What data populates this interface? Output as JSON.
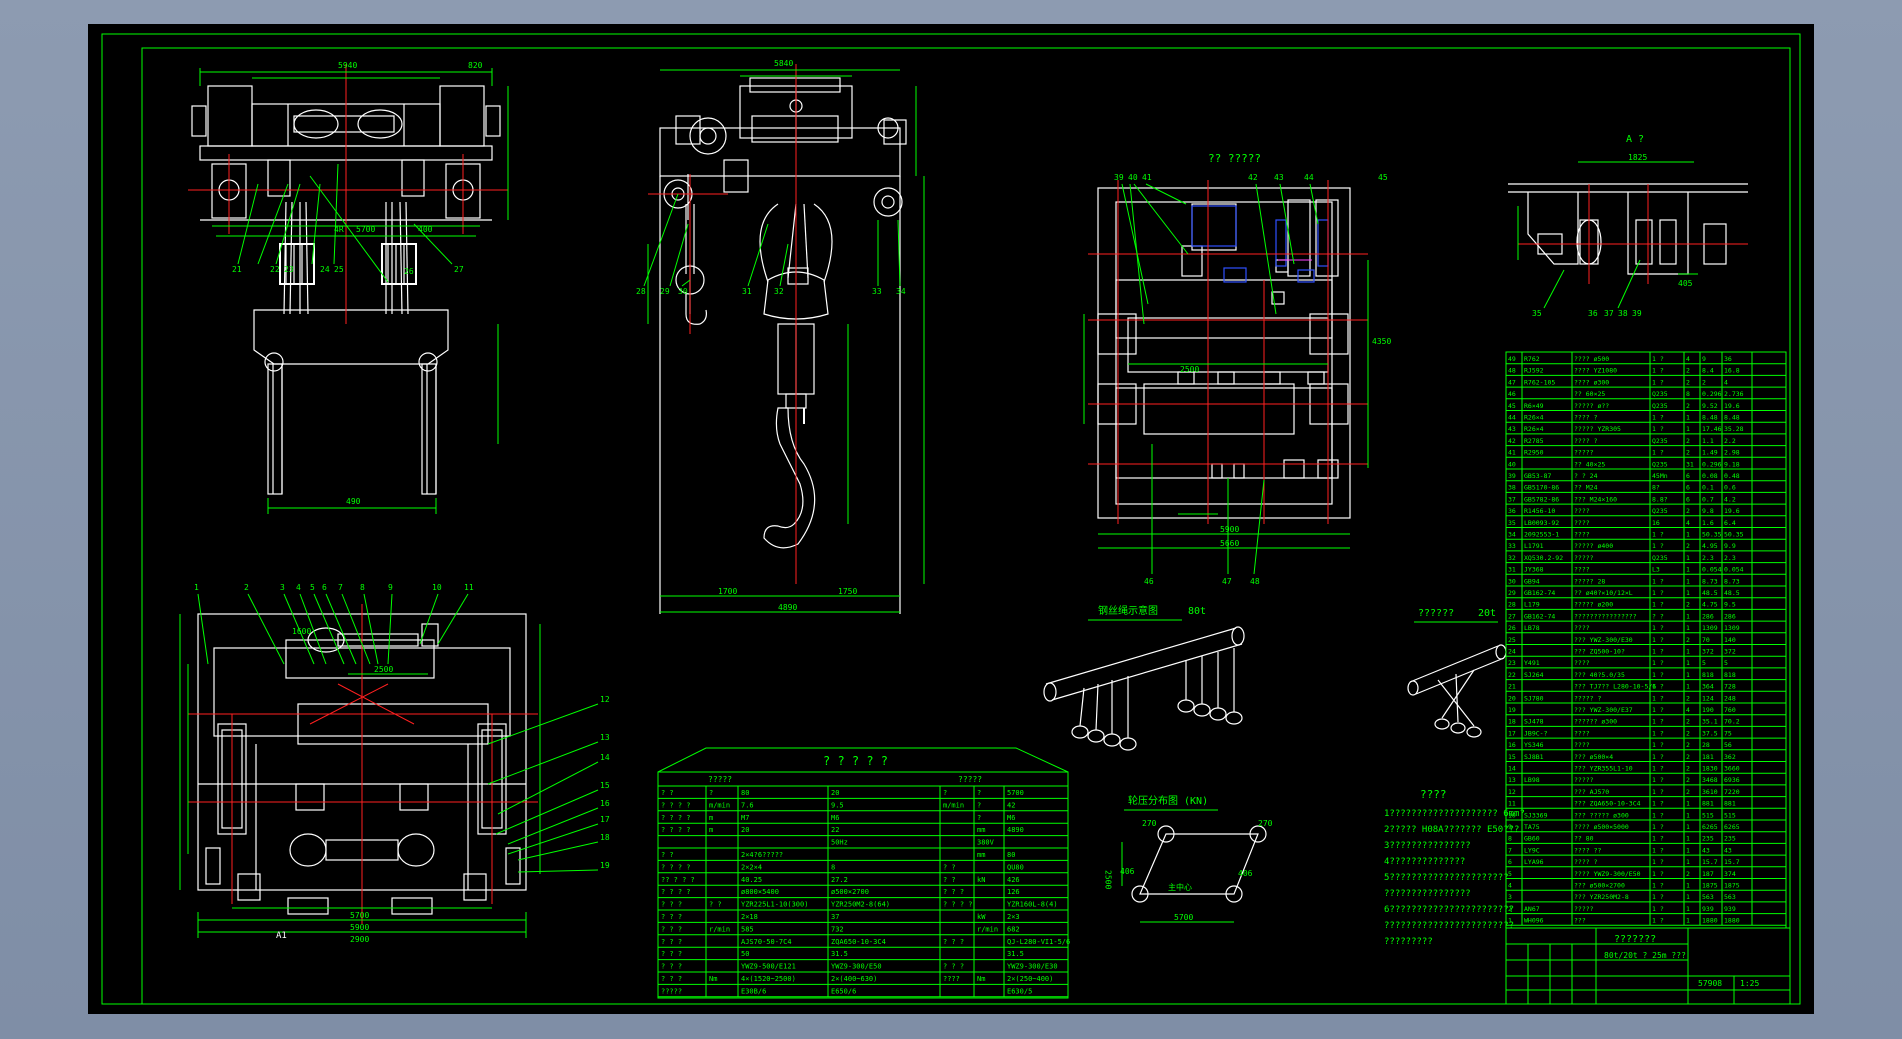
{
  "colors": {
    "background": "#8592a9",
    "sheet": "#000000",
    "frame": "#00ff00",
    "outline": "#ffffff",
    "centerline": "#ff2020",
    "dimension": "#00ff00",
    "blue": "#2040ff",
    "accent": "#ff00ff"
  },
  "frame": {
    "title_a": "A ?",
    "title_section": "?? ?????",
    "label_a1": "A1"
  },
  "front_view": {
    "dims": [
      "5940",
      "820",
      "4R",
      "5700",
      "300",
      "400",
      "490"
    ],
    "callouts": [
      "21",
      "22",
      "23",
      "24",
      "25",
      "26",
      "27"
    ]
  },
  "side_view": {
    "dims": [
      "5840",
      "1700",
      "1750",
      "4890"
    ],
    "callouts": [
      "28",
      "29",
      "30",
      "31",
      "32",
      "33",
      "34"
    ]
  },
  "plan_view": {
    "dims": [
      "5700",
      "5900",
      "2900",
      "2500",
      "1600"
    ],
    "callouts": [
      "1",
      "2",
      "3",
      "4",
      "5",
      "6",
      "7",
      "8",
      "9",
      "10",
      "11",
      "12",
      "13",
      "14",
      "15",
      "16",
      "17",
      "18",
      "19"
    ]
  },
  "section_view": {
    "dims": [
      "5900",
      "5660",
      "2500",
      "4350"
    ],
    "callouts": [
      "39",
      "40",
      "41",
      "42",
      "43",
      "44",
      "45",
      "46",
      "47",
      "48"
    ]
  },
  "detail_a": {
    "dims": [
      "1825",
      "5T",
      "405"
    ],
    "callouts": [
      "35",
      "36",
      "37",
      "38",
      "39"
    ]
  },
  "rope_main": {
    "title": "钢丝绳示意图",
    "capacity": "80t"
  },
  "rope_aux": {
    "title": "??????",
    "capacity": "20t"
  },
  "wheel_load": {
    "title": "轮压分布图 (KN)",
    "loads": [
      "270",
      "270",
      "406",
      "406"
    ],
    "dims": [
      "5700",
      "2500"
    ],
    "center_label": "主中心"
  },
  "notes": {
    "title": "????",
    "lines": [
      "1???????????????????? 6mm?",
      "2?????  H08A???????   E50???",
      "3???????????????",
      "4??????????????",
      "5??????????????????????",
      "   ????????????????",
      "6???????????????????????",
      "   ????????????????????????",
      "   ?????????"
    ]
  },
  "spec_table": {
    "title": "? ? ? ? ?",
    "header": [
      "?????",
      "?????"
    ],
    "rows": [
      [
        "? ?",
        "?",
        "80",
        "20",
        "?",
        "?",
        "5700"
      ],
      [
        "? ? ? ?",
        "m/min",
        "7.6",
        "9.5",
        "m/min",
        "?",
        "42"
      ],
      [
        "? ? ? ?",
        "m",
        "M7",
        "M6",
        "",
        "?",
        "M6"
      ],
      [
        "? ? ? ?",
        "m",
        "20",
        "22",
        "",
        "mm",
        "4890"
      ],
      [
        "",
        "",
        "",
        "50Hz",
        "",
        "380V",
        ""
      ],
      [
        "? ?",
        "",
        "2×4?6?????",
        "",
        "",
        "mm",
        "80"
      ],
      [
        "? ? ? ?",
        "",
        "2×2×4",
        "8",
        "? ?",
        "",
        "QU80"
      ],
      [
        "?? ? ? ?",
        "",
        "40.25",
        "27.2",
        "? ?",
        "kN",
        "426"
      ],
      [
        "? ? ? ?",
        "",
        "ø800×5400",
        "ø500×2700",
        "? ? ?",
        "",
        "126"
      ],
      [
        "? ? ?",
        "? ?",
        "YZR225L1-10(300)",
        "YZR250M2-8(64)",
        "? ? ? ?",
        "",
        "YZR160L-8(4)"
      ],
      [
        "? ? ?",
        "",
        "2×18",
        "37",
        "",
        "kW",
        "2×3"
      ],
      [
        "? ? ?",
        "r/min",
        "585",
        "732",
        "",
        "r/min",
        "682"
      ],
      [
        "? ? ?",
        "",
        "AJS70-50-7C4",
        "ZQA650-10-3C4",
        "? ? ?",
        "",
        "QJ-L280-VI1-5/6"
      ],
      [
        "? ? ?",
        "",
        "50",
        "31.5",
        "",
        "",
        "31.5"
      ],
      [
        "? ? ?",
        "",
        "YWZ9-500/E121",
        "YWZ9-300/E50",
        "? ? ?",
        "",
        "YWZ9-300/E30"
      ],
      [
        "? ? ?",
        "Nm",
        "4×(1520~2500)",
        "2×(400~630)",
        "????",
        "Nm",
        "2×(250~400)"
      ],
      [
        "?????",
        "",
        "E30B/6",
        "E650/6",
        "",
        "",
        "E630/5"
      ]
    ]
  },
  "bom": {
    "rows": [
      [
        "49",
        "R762",
        "???? ø500",
        "1 ?",
        "4",
        "9",
        "36"
      ],
      [
        "48",
        "RJ592",
        "???? YZ1080",
        "1 ?",
        "2",
        "8.4",
        "16.8"
      ],
      [
        "47",
        "R762-105",
        "???? ø300",
        "1 ?",
        "2",
        "2",
        "4"
      ],
      [
        "46",
        "",
        "?? 60×25",
        "Q235",
        "8",
        "0.296",
        "2.736"
      ],
      [
        "45",
        "R6×49",
        "????? ø??",
        "Q235",
        "2",
        "9.52",
        "19.6"
      ],
      [
        "44",
        "R26×4",
        "???? ?",
        "1 ?",
        "1",
        "8.48",
        "8.48"
      ],
      [
        "43",
        "R26×4",
        "????? YZR305",
        "1 ?",
        "1",
        "17.46",
        "35.28"
      ],
      [
        "42",
        "R2785",
        "???? ?",
        "Q235",
        "2",
        "1.1",
        "2.2"
      ],
      [
        "41",
        "R2950",
        "?????",
        "1 ?",
        "2",
        "1.49",
        "2.98"
      ],
      [
        "40",
        "",
        "?? 40×25",
        "Q235",
        "31",
        "0.296",
        "9.18"
      ],
      [
        "39",
        "GB53-87",
        "? ? 24",
        "45Mn",
        "6",
        "0.08",
        "0.48"
      ],
      [
        "38",
        "GB5170-86",
        "?? M24",
        "8?",
        "6",
        "0.1",
        "0.6"
      ],
      [
        "37",
        "GB5782-86",
        "??? M24×160",
        "8.8?",
        "6",
        "0.7",
        "4.2"
      ],
      [
        "36",
        "R1456-10",
        "????",
        "Q235",
        "2",
        "9.8",
        "19.6"
      ],
      [
        "35",
        "LB0093-92",
        "????",
        "16",
        "4",
        "1.6",
        "6.4"
      ],
      [
        "34",
        "2092553-1",
        "????",
        "1 ?",
        "1",
        "50.35",
        "50.35"
      ],
      [
        "33",
        "L1791",
        "????? ø400",
        "1 ?",
        "2",
        "4.95",
        "9.9"
      ],
      [
        "32",
        "XQ530.2-92",
        "?????",
        "Q235",
        "1",
        "2.3",
        "2.3"
      ],
      [
        "31",
        "JY368",
        "????",
        "L3",
        "1",
        "0.054",
        "0.054"
      ],
      [
        "30",
        "GB94",
        "????? 28",
        "1 ?",
        "1",
        "8.73",
        "8.73"
      ],
      [
        "29",
        "GB162-74",
        "?? ø40?×10/12×L",
        "1 ?",
        "1",
        "48.5",
        "48.5"
      ],
      [
        "28",
        "L179",
        "????? ø200",
        "1 ?",
        "2",
        "4.75",
        "9.5"
      ],
      [
        "27",
        "GB162-74",
        "????????????????",
        "? ?",
        "1",
        "286",
        "286"
      ],
      [
        "26",
        "LB78",
        "????",
        "1 ?",
        "1",
        "1309",
        "1309"
      ],
      [
        "25",
        "",
        "??? YWZ-300/E30",
        "1 ?",
        "2",
        "70",
        "140"
      ],
      [
        "24",
        "",
        "??? ZQ500-10?",
        "1 ?",
        "1",
        "372",
        "372"
      ],
      [
        "23",
        "Y491",
        "????",
        "1 ?",
        "1",
        "5",
        "5"
      ],
      [
        "22",
        "SJ264",
        "??? 40?5.0/35",
        "1 ?",
        "1",
        "818",
        "818"
      ],
      [
        "21",
        "",
        "??? TJ7?? L280-10-5/6",
        "1 ?",
        "1",
        "364",
        "728"
      ],
      [
        "20",
        "SJ780",
        "????? ?",
        "1 ?",
        "2",
        "124",
        "248"
      ],
      [
        "19",
        "",
        "??? YWZ-300/E37",
        "1 ?",
        "4",
        "190",
        "760"
      ],
      [
        "18",
        "SJ478",
        "?????? ø300",
        "1 ?",
        "2",
        "35.1",
        "70.2"
      ],
      [
        "17",
        "JB9C-?",
        "????",
        "1 ?",
        "2",
        "37.5",
        "75"
      ],
      [
        "16",
        "YS346",
        "????",
        "1 ?",
        "2",
        "28",
        "56"
      ],
      [
        "15",
        "SJ8B1",
        "??? ø500×4",
        "1 ?",
        "2",
        "181",
        "362"
      ],
      [
        "14",
        "",
        "??? YZR355L1-10",
        "1 ?",
        "2",
        "1830",
        "3660"
      ],
      [
        "13",
        "LB98",
        "?????",
        "1 ?",
        "2",
        "3468",
        "6936"
      ],
      [
        "12",
        "",
        "??? AJ570",
        "1 ?",
        "2",
        "3610",
        "7220"
      ],
      [
        "11",
        "",
        "??? ZQA650-10-3C4",
        "1 ?",
        "1",
        "881",
        "881"
      ],
      [
        "10",
        "SJ3369",
        "???  ????? ø300",
        "1 ?",
        "1",
        "515",
        "515"
      ],
      [
        "9",
        "TA75",
        "???? ø500×5000",
        "1 ?",
        "1",
        "6265",
        "6265"
      ],
      [
        "8",
        "GB60",
        "?? 80",
        "1 ?",
        "1",
        "235",
        "235"
      ],
      [
        "7",
        "LY9C",
        "???? ??",
        "1 ?",
        "1",
        "43",
        "43"
      ],
      [
        "6",
        "LYA96",
        "???? ?",
        "1 ?",
        "1",
        "15.7",
        "15.7"
      ],
      [
        "5",
        "",
        "???? YWZ9-300/E50",
        "1 ?",
        "2",
        "187",
        "374"
      ],
      [
        "4",
        "",
        "??? ø500×2700",
        "1 ?",
        "1",
        "1875",
        "1875"
      ],
      [
        "3",
        "",
        "??? YZR250M2-8",
        "1 ?",
        "1",
        "563",
        "563"
      ],
      [
        "2",
        "AN67",
        "?????",
        "1 ?",
        "1",
        "939",
        "939"
      ],
      [
        "1",
        "WH096",
        "???",
        "1 ?",
        "1",
        "1880",
        "1880"
      ]
    ],
    "title_block": {
      "title": "???????",
      "subtitle": "80t/20t ? 25m ???",
      "weight": "57908",
      "scale": "1:25"
    }
  }
}
